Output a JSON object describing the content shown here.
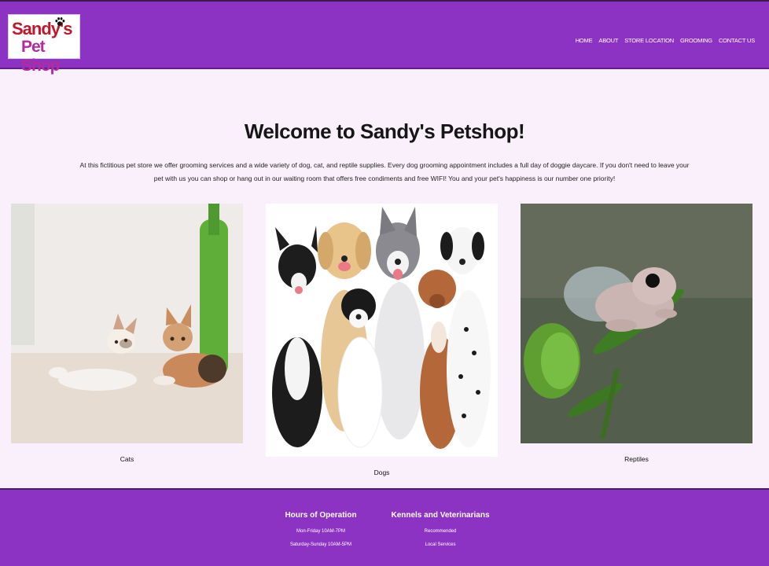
{
  "header": {
    "logo_line1": "Sandy's",
    "logo_line2": "Pet Shop",
    "nav": [
      "HOME",
      "ABOUT",
      "STORE LOCATION",
      "GROOMING",
      "CONTACT US"
    ]
  },
  "main": {
    "title": "Welcome to Sandy's Petshop!",
    "intro": "At this fictitious pet store we offer grooming services and a wide variety of dog, cat, and reptile supplies. Every dog grooming appointment includes a full day of doggie daycare. If you don't need to leave your pet with us you can shop or hang out in our waiting room that offers free condiments and free WIFI! You and your pet's happiness is our number one priority!",
    "cards": [
      {
        "caption": "Cats"
      },
      {
        "caption": "Dogs"
      },
      {
        "caption": "Reptiles"
      }
    ]
  },
  "footer": {
    "hours": {
      "heading": "Hours of Operation",
      "lines": [
        "Mon-Friday 10AM-7PM",
        "Saturday-Sunday 10AM-5PM"
      ]
    },
    "kennels": {
      "heading": "Kennels and Veterinarians",
      "lines": [
        "Recommended",
        "Local Services"
      ]
    }
  },
  "colors": {
    "brand_purple": "#8c33c4",
    "page_bg": "#faf0fb",
    "logo_red": "#c0182a",
    "logo_magenta": "#b42b9e"
  }
}
